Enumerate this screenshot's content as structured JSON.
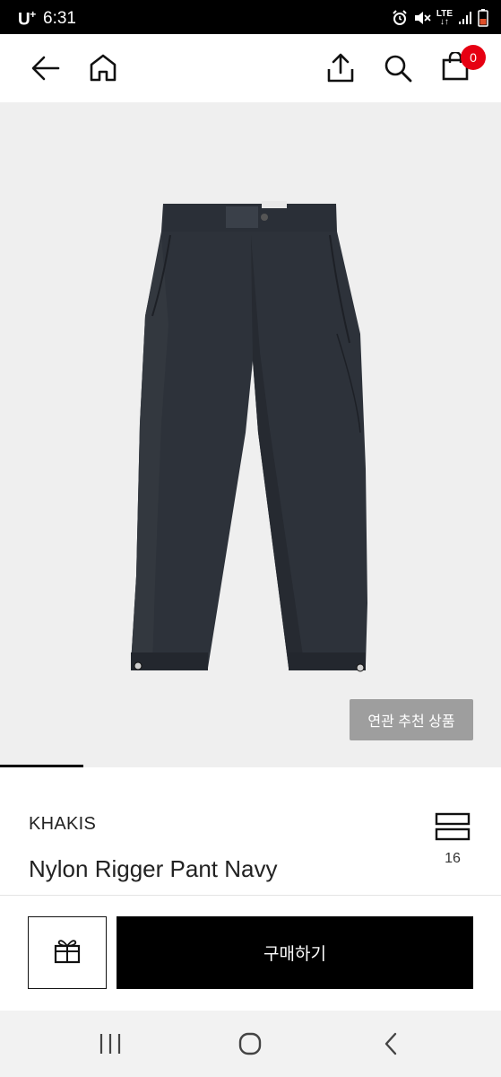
{
  "status_bar": {
    "carrier": "U",
    "carrier_sup": "+",
    "time": "6:31",
    "network": "LTE",
    "icons": [
      "alarm-icon",
      "mute-icon",
      "lte-icon",
      "signal-icon",
      "battery-icon"
    ]
  },
  "header": {
    "icons": [
      "back-arrow-icon",
      "home-icon",
      "share-icon",
      "search-icon",
      "cart-icon"
    ],
    "cart_count": "0",
    "badge_color": "#e60012"
  },
  "gallery": {
    "product_image": "navy-nylon-pants",
    "related_button_label": "연관 추천 상품",
    "background_color": "#efefef"
  },
  "product": {
    "brand": "KHAKIS",
    "name": "Nylon Rigger Pant Navy",
    "wishlist_icon": "stack-icon",
    "wishlist_count": "16"
  },
  "actions": {
    "gift_icon": "gift-icon",
    "buy_label": "구매하기"
  },
  "system_nav": {
    "icons": [
      "recents-icon",
      "home-circle-icon",
      "back-chevron-icon"
    ]
  }
}
